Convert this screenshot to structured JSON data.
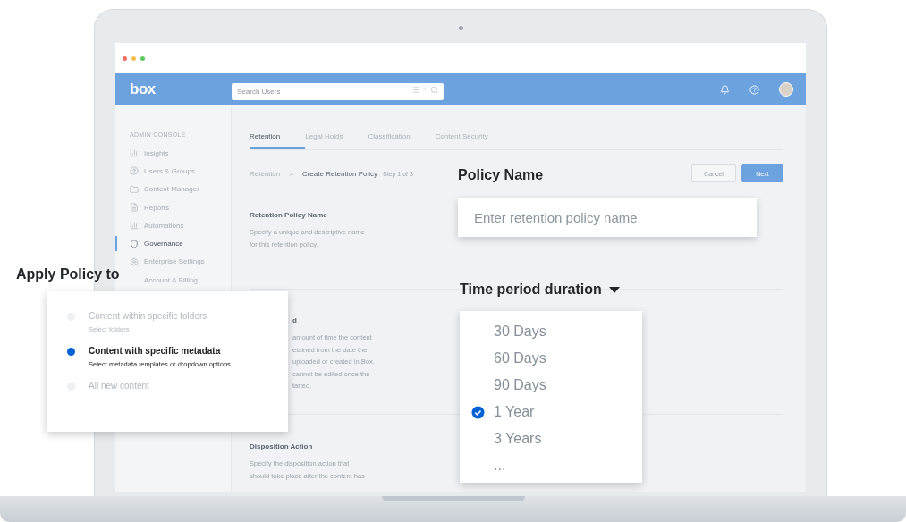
{
  "app": {
    "logo": "box",
    "search": {
      "placeholder": "Search Users"
    }
  },
  "sidebar": {
    "heading": "ADMIN CONSOLE",
    "items": [
      {
        "label": "Insights",
        "kind": "chart",
        "selected": false
      },
      {
        "label": "Users & Groups",
        "kind": "user",
        "selected": false
      },
      {
        "label": "Content Manager",
        "kind": "folder",
        "selected": false
      },
      {
        "label": "Reports",
        "kind": "report",
        "selected": false
      },
      {
        "label": "Automations",
        "kind": "chart",
        "selected": false
      },
      {
        "label": "Governance",
        "kind": "shield",
        "selected": true
      },
      {
        "label": "Enterprise Settings",
        "kind": "gear",
        "selected": false
      },
      {
        "label": "Account & Billing",
        "kind": "none",
        "selected": false
      }
    ]
  },
  "tabs": [
    {
      "label": "Retention",
      "selected": true
    },
    {
      "label": "Legal Holds",
      "selected": false
    },
    {
      "label": "Classification",
      "selected": false
    },
    {
      "label": "Content Security",
      "selected": false
    }
  ],
  "breadcrumb": {
    "parent": "Retention",
    "separator": ">",
    "current": "Create Retention Policy",
    "step": "Step 1 of 3"
  },
  "buttons": [
    {
      "label": "Cancel",
      "kind": "secondary"
    },
    {
      "label": "Next",
      "kind": "primary"
    }
  ],
  "sections": [
    {
      "title": "Retention Policy Name",
      "description": [
        "Specify a unique and descriptive name",
        "for this retention policy."
      ]
    },
    {
      "title": "d",
      "description": [
        "amount of time the content",
        "etained from the date the",
        "uploaded or created in Box.",
        "cannot be edited once the",
        "tarted."
      ]
    },
    {
      "title": "Disposition Action",
      "description": [
        "Specify the disposition action that",
        "should take place after the content has"
      ]
    }
  ],
  "policy_name": {
    "title": "Policy Name",
    "placeholder": "Enter retention policy name"
  },
  "time_period": {
    "title": "Time period duration",
    "options": [
      {
        "label": "30 Days",
        "selected": false
      },
      {
        "label": "60 Days",
        "selected": false
      },
      {
        "label": "90 Days",
        "selected": false
      },
      {
        "label": "1 Year",
        "selected": true
      },
      {
        "label": "3 Years",
        "selected": false
      },
      {
        "label": "...",
        "selected": false
      }
    ]
  },
  "apply_policy": {
    "title": "Apply Policy to",
    "options": [
      {
        "label": "Content within specific folders",
        "hint": "Select folders",
        "selected": false
      },
      {
        "label": "Content with specific metadata",
        "hint": "Select metadata templates or dropdown options",
        "selected": true
      },
      {
        "label": "All new content",
        "selected": false
      }
    ]
  }
}
